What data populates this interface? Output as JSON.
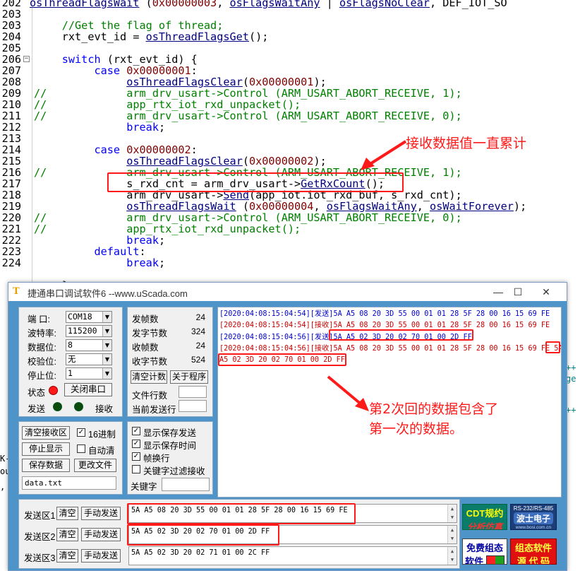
{
  "editor": {
    "lines": [
      {
        "n": "202",
        "indent": 0,
        "fold": "",
        "cm": "",
        "parts": [
          {
            "c": "f",
            "t": "osThreadFlagsWait"
          },
          {
            "c": "p",
            "t": " ("
          },
          {
            "c": "n",
            "t": "0x00000003"
          },
          {
            "c": "p",
            "t": ", "
          },
          {
            "c": "f",
            "t": "osFlagsWaitAny"
          },
          {
            "c": "p",
            "t": " | "
          },
          {
            "c": "f",
            "t": "osFlagsNoClear"
          },
          {
            "c": "p",
            "t": ", DEF_IOT_SO"
          }
        ]
      },
      {
        "n": "203",
        "indent": 1,
        "fold": "",
        "cm": "",
        "parts": []
      },
      {
        "n": "203",
        "indent": 5,
        "fold": "",
        "cm": "",
        "parts": [
          {
            "c": "c",
            "t": "//Get the flag of thread;"
          }
        ]
      },
      {
        "n": "204",
        "indent": 5,
        "fold": "",
        "cm": "",
        "parts": [
          {
            "c": "p",
            "t": "rxt_evt_id = "
          },
          {
            "c": "f",
            "t": "osThreadFlagsGet"
          },
          {
            "c": "p",
            "t": "();"
          }
        ]
      },
      {
        "n": "205",
        "indent": 1,
        "fold": "",
        "cm": "",
        "parts": []
      },
      {
        "n": "206",
        "indent": 5,
        "fold": "−",
        "cm": "",
        "parts": [
          {
            "c": "k",
            "t": "switch"
          },
          {
            "c": "p",
            "t": " (rxt_evt_id) {"
          }
        ]
      },
      {
        "n": "207",
        "indent": 10,
        "fold": "",
        "cm": "",
        "parts": [
          {
            "c": "k",
            "t": "case"
          },
          {
            "c": "p",
            "t": " "
          },
          {
            "c": "n",
            "t": "0x00000001"
          },
          {
            "c": "p",
            "t": ":"
          }
        ]
      },
      {
        "n": "208",
        "indent": 15,
        "fold": "",
        "cm": "",
        "parts": [
          {
            "c": "f",
            "t": "osThreadFlagsClear"
          },
          {
            "c": "p",
            "t": "("
          },
          {
            "c": "n",
            "t": "0x00000001"
          },
          {
            "c": "p",
            "t": ");"
          }
        ]
      },
      {
        "n": "209",
        "indent": 15,
        "fold": "",
        "cm": "//",
        "parts": [
          {
            "c": "c",
            "t": "arm_drv_usart->Control (ARM_USART_ABORT_RECEIVE, 1);"
          }
        ]
      },
      {
        "n": "210",
        "indent": 15,
        "fold": "",
        "cm": "//",
        "parts": [
          {
            "c": "c",
            "t": "app_rtx_iot_rxd_unpacket();"
          }
        ]
      },
      {
        "n": "211",
        "indent": 15,
        "fold": "",
        "cm": "//",
        "parts": [
          {
            "c": "c",
            "t": "arm_drv_usart->Control (ARM_USART_ABORT_RECEIVE, 0);"
          }
        ]
      },
      {
        "n": "212",
        "indent": 15,
        "fold": "",
        "cm": "",
        "parts": [
          {
            "c": "k",
            "t": "break"
          },
          {
            "c": "p",
            "t": ";"
          }
        ]
      },
      {
        "n": "213",
        "indent": 1,
        "fold": "",
        "cm": "",
        "parts": []
      },
      {
        "n": "214",
        "indent": 10,
        "fold": "",
        "cm": "",
        "parts": [
          {
            "c": "k",
            "t": "case"
          },
          {
            "c": "p",
            "t": " "
          },
          {
            "c": "n",
            "t": "0x00000002"
          },
          {
            "c": "p",
            "t": ":"
          }
        ]
      },
      {
        "n": "215",
        "indent": 15,
        "fold": "",
        "cm": "",
        "parts": [
          {
            "c": "f",
            "t": "osThreadFlagsClear"
          },
          {
            "c": "p",
            "t": "("
          },
          {
            "c": "n",
            "t": "0x00000002"
          },
          {
            "c": "p",
            "t": ");"
          }
        ]
      },
      {
        "n": "216",
        "indent": 15,
        "fold": "",
        "cm": "//",
        "parts": [
          {
            "c": "c",
            "t": "arm_drv_usart->Control (ARM_USART_ABORT_RECEIVE, 1);"
          }
        ]
      },
      {
        "n": "217",
        "indent": 15,
        "fold": "",
        "cm": "",
        "parts": [
          {
            "c": "p",
            "t": "s_rxd_cnt = arm_drv_usart->"
          },
          {
            "c": "f",
            "t": "GetRxCount"
          },
          {
            "c": "p",
            "t": "();"
          }
        ]
      },
      {
        "n": "218",
        "indent": 15,
        "fold": "",
        "cm": "",
        "parts": [
          {
            "c": "p",
            "t": "arm_drv_usart->"
          },
          {
            "c": "f",
            "t": "Send"
          },
          {
            "c": "p",
            "t": "(app_iot.iot_rxd_buf, s_rxd_cnt);"
          }
        ]
      },
      {
        "n": "219",
        "indent": 15,
        "fold": "",
        "cm": "",
        "parts": [
          {
            "c": "f",
            "t": "osThreadFlagsWait"
          },
          {
            "c": "p",
            "t": " ("
          },
          {
            "c": "n",
            "t": "0x00000004"
          },
          {
            "c": "p",
            "t": ", "
          },
          {
            "c": "f",
            "t": "osFlagsWaitAny"
          },
          {
            "c": "p",
            "t": ", "
          },
          {
            "c": "f",
            "t": "osWaitForever"
          },
          {
            "c": "p",
            "t": ");"
          }
        ]
      },
      {
        "n": "220",
        "indent": 15,
        "fold": "",
        "cm": "//",
        "parts": [
          {
            "c": "c",
            "t": "arm_drv_usart->Control (ARM_USART_ABORT_RECEIVE, 0);"
          }
        ]
      },
      {
        "n": "221",
        "indent": 15,
        "fold": "",
        "cm": "//",
        "parts": [
          {
            "c": "c",
            "t": "app_rtx_iot_rxd_unpacket();"
          }
        ]
      },
      {
        "n": "222",
        "indent": 15,
        "fold": "",
        "cm": "",
        "parts": [
          {
            "c": "k",
            "t": "break"
          },
          {
            "c": "p",
            "t": ";"
          }
        ]
      },
      {
        "n": "223",
        "indent": 10,
        "fold": "",
        "cm": "",
        "parts": [
          {
            "c": "k",
            "t": "default"
          },
          {
            "c": "p",
            "t": ":"
          }
        ]
      },
      {
        "n": "224",
        "indent": 15,
        "fold": "",
        "cm": "",
        "parts": [
          {
            "c": "k",
            "t": "break"
          },
          {
            "c": "p",
            "t": ";"
          }
        ]
      },
      {
        "n": "",
        "indent": 1,
        "fold": "",
        "cm": "",
        "parts": []
      },
      {
        "n": "",
        "indent": 5,
        "fold": "",
        "cm": "",
        "parts": [
          {
            "c": "p",
            "t": "}"
          }
        ]
      }
    ]
  },
  "annotations": {
    "top": "接收数据值一直累计",
    "bottom_line1": "第2次回的数据包含了",
    "bottom_line2": "第一次的数据。"
  },
  "peek": {
    "left": [
      "K-",
      "ou",
      ","
    ],
    "right": [
      "++",
      "ge",
      "",
      "++"
    ]
  },
  "window": {
    "title": "捷通串口调试软件6  --www.uScada.com",
    "minimize": "—",
    "maximize": "☐",
    "close": "✕",
    "port": {
      "port_label": "端  口:",
      "port_value": "COM18",
      "baud_label": "波特率:",
      "baud_value": "115200",
      "databits_label": "数据位:",
      "databits_value": "8",
      "parity_label": "校验位:",
      "parity_value": "无",
      "stopbits_label": "停止位:",
      "stopbits_value": "1",
      "status_label": "状态",
      "close_port_button": "关闭串口",
      "send_label": "发送",
      "recv_label": "接收"
    },
    "stats": {
      "tx_frames_label": "发帧数",
      "tx_frames": "24",
      "tx_bytes_label": "发字节数",
      "tx_bytes": "324",
      "rx_frames_label": "收帧数",
      "rx_frames": "24",
      "rx_bytes_label": "收字节数",
      "rx_bytes": "524",
      "clear_count_button": "清空计数",
      "about_button": "关于程序",
      "file_lines_label": "文件行数",
      "current_line_label": "当前发送行"
    },
    "recv_controls": {
      "clear_recv_button": "清空接收区",
      "hex_label": "16进制",
      "stop_display_button": "停止显示",
      "auto_clear_label": "自动清",
      "save_data_button": "保存数据",
      "change_file_button": "更改文件",
      "filename": "data.txt"
    },
    "options": {
      "show_save_send": "显示保存发送",
      "show_save_time": "显示保存时间",
      "frame_newline": "帧换行",
      "keyword_filter": "关键字过滤接收",
      "keyword_label": "关键字"
    },
    "recv_log": [
      {
        "type": "send",
        "text": "[2020:04:08:15:04:54][发送]5A A5 08 20 3D 55 00 01 01 28 5F 28 00 16 15 69 FE"
      },
      {
        "type": "recv",
        "text": "[2020:04:08:15:04:54][接收]5A A5 08 20 3D 55 00 01 01 28 5F 28 00 16 15 69 FE"
      },
      {
        "type": "send",
        "text": "[2020:04:08:15:04:56][发送]5A A5 02 3D 20 02 70 01 00 2D FF"
      },
      {
        "type": "recv",
        "text": "[2020:04:08:15:04:56][接收]5A A5 08 20 3D 55 00 01 01 28 5F 28 00 16 15 69 FE 5A"
      },
      {
        "type": "recv",
        "text": "A5 02 3D 20 02 70 01 00 2D FF"
      }
    ],
    "send_areas": [
      {
        "label": "发送区1",
        "clear": "清空",
        "manual": "手动发送",
        "data": "5A A5 08 20 3D 55 00 01 01 28 5F 28 00 16 15 69 FE"
      },
      {
        "label": "发送区2",
        "clear": "清空",
        "manual": "手动发送",
        "data": "5A A5 02 3D 20 02 70 01 00 2D FF"
      },
      {
        "label": "发送区3",
        "clear": "清空",
        "manual": "手动发送",
        "data": "5A A5 02 3D 20 02 71 01 00 2C FF"
      }
    ],
    "ads": {
      "cdt_line1": "CDT规约",
      "cdt_line2": "分析仿真",
      "rs_line1": "RS-232/RS-485",
      "rs_line2": "波士电子",
      "rs_line3": "www.bosi.com.cn",
      "free_line1": "免费组态",
      "free_line2": "软件",
      "config_line1": "组态软件",
      "config_line2": "源 代 码"
    },
    "colors": {
      "client_bg": "#4f94c8",
      "led_red": "#ff1a1a",
      "led_green": "#0a7a0a",
      "send_text": "#0000c8",
      "recv_text": "#c80000",
      "highlight": "#ff1a1a"
    }
  }
}
